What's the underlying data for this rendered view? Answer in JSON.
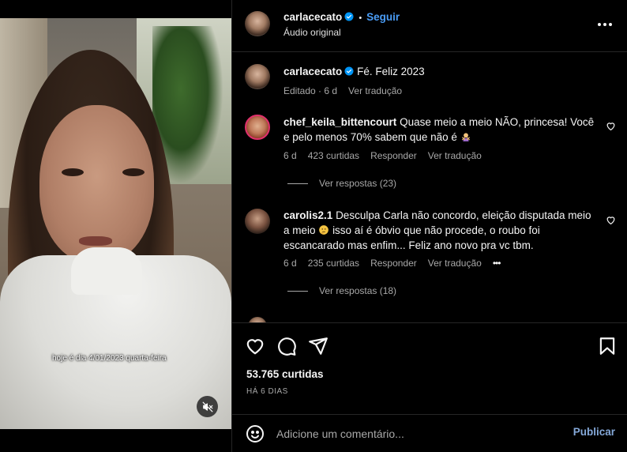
{
  "video": {
    "overlay_text": "hoje é dia 4/01/2023 quarta-feira",
    "mute_icon": "speaker-muted-icon"
  },
  "header": {
    "username": "carlacecato",
    "separator": "•",
    "follow_label": "Seguir",
    "audio_label": "Áudio original",
    "more_icon": "more-horizontal-icon"
  },
  "caption": {
    "username": "carlacecato",
    "text": "Fé. Feliz 2023",
    "edited": "Editado · 6 d",
    "translate": "Ver tradução"
  },
  "comments": [
    {
      "username": "chef_keila_bittencourt",
      "text": "Quase meio a meio NÃO, princesa! Você e pelo menos 70% sabem que não é",
      "emoji": "woman-gesturing-no-emoji",
      "age": "6 d",
      "likes": "423 curtidas",
      "reply": "Responder",
      "translate": "Ver tradução",
      "replies": "Ver respostas (23)"
    },
    {
      "username": "carolis2.1",
      "text_a": "Desculpa Carla não concordo, eleição disputada meio a meio",
      "emoji": "thinking-face-emoji",
      "text_b": "isso aí é óbvio que não procede, o roubo foi escancarado mas enfim... Feliz ano novo pra vc tbm.",
      "age": "6 d",
      "likes": "235 curtidas",
      "reply": "Responder",
      "translate": "Ver tradução",
      "more": "•••",
      "replies": "Ver respostas (18)"
    }
  ],
  "actions": {
    "like_icon": "heart-icon",
    "comment_icon": "comment-bubble-icon",
    "share_icon": "paper-plane-icon",
    "save_icon": "bookmark-icon",
    "likes_count": "53.765 curtidas",
    "timestamp": "HÁ 6 DIAS"
  },
  "composer": {
    "emoji_icon": "smiley-icon",
    "placeholder": "Adicione um comentário...",
    "post_label": "Publicar"
  },
  "colors": {
    "background": "#000000",
    "link_blue": "#4a9cf5",
    "muted": "#a8a8a8",
    "divider": "#262626"
  }
}
